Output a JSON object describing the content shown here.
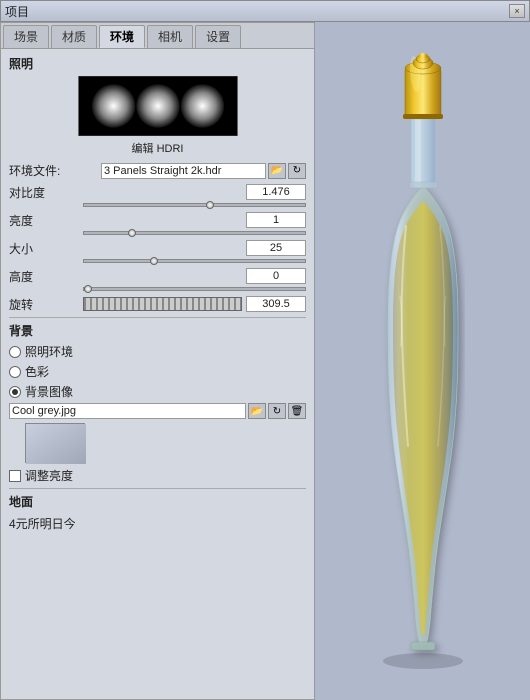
{
  "window": {
    "title": "项目",
    "close_btn": "×"
  },
  "tabs": {
    "items": [
      "场景",
      "材质",
      "环境",
      "相机",
      "设置"
    ],
    "active": "环境"
  },
  "lighting": {
    "section_title": "照明",
    "hdri_label": "编辑 HDRI",
    "env_file_label": "环境文件:",
    "env_file_value": "3 Panels Straight 2k.hdr",
    "contrast_label": "对比度",
    "contrast_value": "1.476",
    "brightness_label": "亮度",
    "brightness_value": "1",
    "size_label": "大小",
    "size_value": "25",
    "height_label": "高度",
    "height_value": "0",
    "rotation_label": "旋转",
    "rotation_value": "309.5"
  },
  "background": {
    "section_title": "背景",
    "option1": "照明环境",
    "option2": "色彩",
    "option3": "背景图像",
    "selected": "option3",
    "file_value": "Cool grey.jpg",
    "adjust_brightness": "调整亮度"
  },
  "ground": {
    "section_title": "地面",
    "option1": "4元所明日今"
  },
  "icons": {
    "folder": "📁",
    "refresh": "↻",
    "delete": "🗑",
    "scroll_up": "▲",
    "scroll_down": "▼"
  }
}
